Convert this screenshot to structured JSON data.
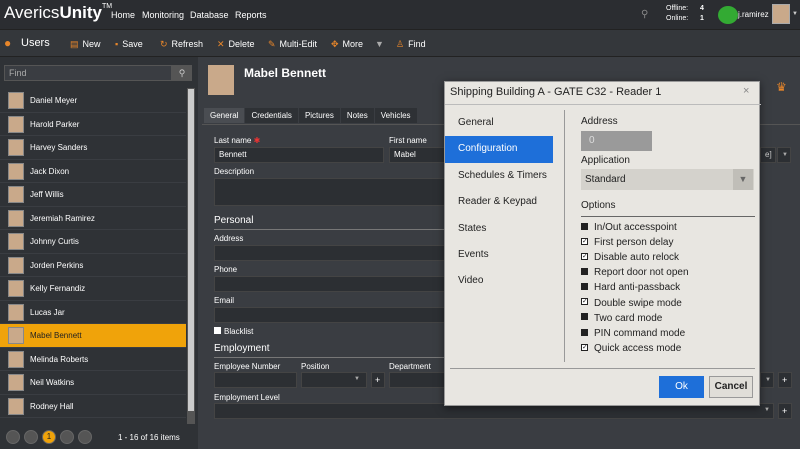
{
  "app": {
    "logo_a": "Averics",
    "logo_b": "Unity",
    "tm": "TM"
  },
  "nav": [
    "Home",
    "Monitoring",
    "Database",
    "Reports"
  ],
  "status": {
    "offline_label": "Offline:",
    "offline_count": "4",
    "online_label": "Online:",
    "online_count": "1"
  },
  "current_user": "j.ramirez",
  "toolbar": {
    "title": "Users",
    "new": "New",
    "save": "Save",
    "refresh": "Refresh",
    "delete": "Delete",
    "multi_edit": "Multi-Edit",
    "more": "More",
    "find": "Find"
  },
  "sidebar": {
    "find_placeholder": "Find",
    "users": [
      "Daniel Meyer",
      "Harold Parker",
      "Harvey Sanders",
      "Jack Dixon",
      "Jeff Willis",
      "Jeremiah Ramirez",
      "Johnny Curtis",
      "Jorden Perkins",
      "Kelly Fernandiz",
      "Lucas Jar",
      "Mabel Bennett",
      "Melinda Roberts",
      "Neil Watkins",
      "Rodney Hall"
    ],
    "selected_index": 10,
    "pager_current": "1",
    "pager_text": "1 - 16 of 16 items"
  },
  "detail": {
    "name": "Mabel Bennett",
    "tabs": [
      "General",
      "Credentials",
      "Pictures",
      "Notes",
      "Vehicles"
    ],
    "last_name_label": "Last name",
    "last_name": "Bennett",
    "first_name_label": "First name",
    "first_name": "Mabel",
    "description_label": "Description",
    "personal_label": "Personal",
    "address_label": "Address",
    "phone_label": "Phone",
    "email_label": "Email",
    "blacklist_label": "Blacklist",
    "employment_label": "Employment",
    "employee_number_label": "Employee Number",
    "position_label": "Position",
    "department_label": "Department",
    "employment_level_label": "Employment Level"
  },
  "modal": {
    "title": "Shipping Building A - GATE C32 - Reader 1",
    "nav": [
      "General",
      "Configuration",
      "Schedules & Timers",
      "Reader & Keypad",
      "States",
      "Events",
      "Video"
    ],
    "active_nav": 1,
    "address_label": "Address",
    "address_value": "0",
    "application_label": "Application",
    "application_value": "Standard",
    "options_label": "Options",
    "options": [
      {
        "label": "In/Out accesspoint",
        "checked": false
      },
      {
        "label": "First person delay",
        "checked": true
      },
      {
        "label": "Disable auto relock",
        "checked": true
      },
      {
        "label": "Report door not open",
        "checked": false
      },
      {
        "label": "Hard anti-passback",
        "checked": false
      },
      {
        "label": "Double swipe mode",
        "checked": true
      },
      {
        "label": "Two card mode",
        "checked": false
      },
      {
        "label": "PIN command mode",
        "checked": false
      },
      {
        "label": "Quick access mode",
        "checked": true
      }
    ],
    "ok": "Ok",
    "cancel": "Cancel"
  }
}
